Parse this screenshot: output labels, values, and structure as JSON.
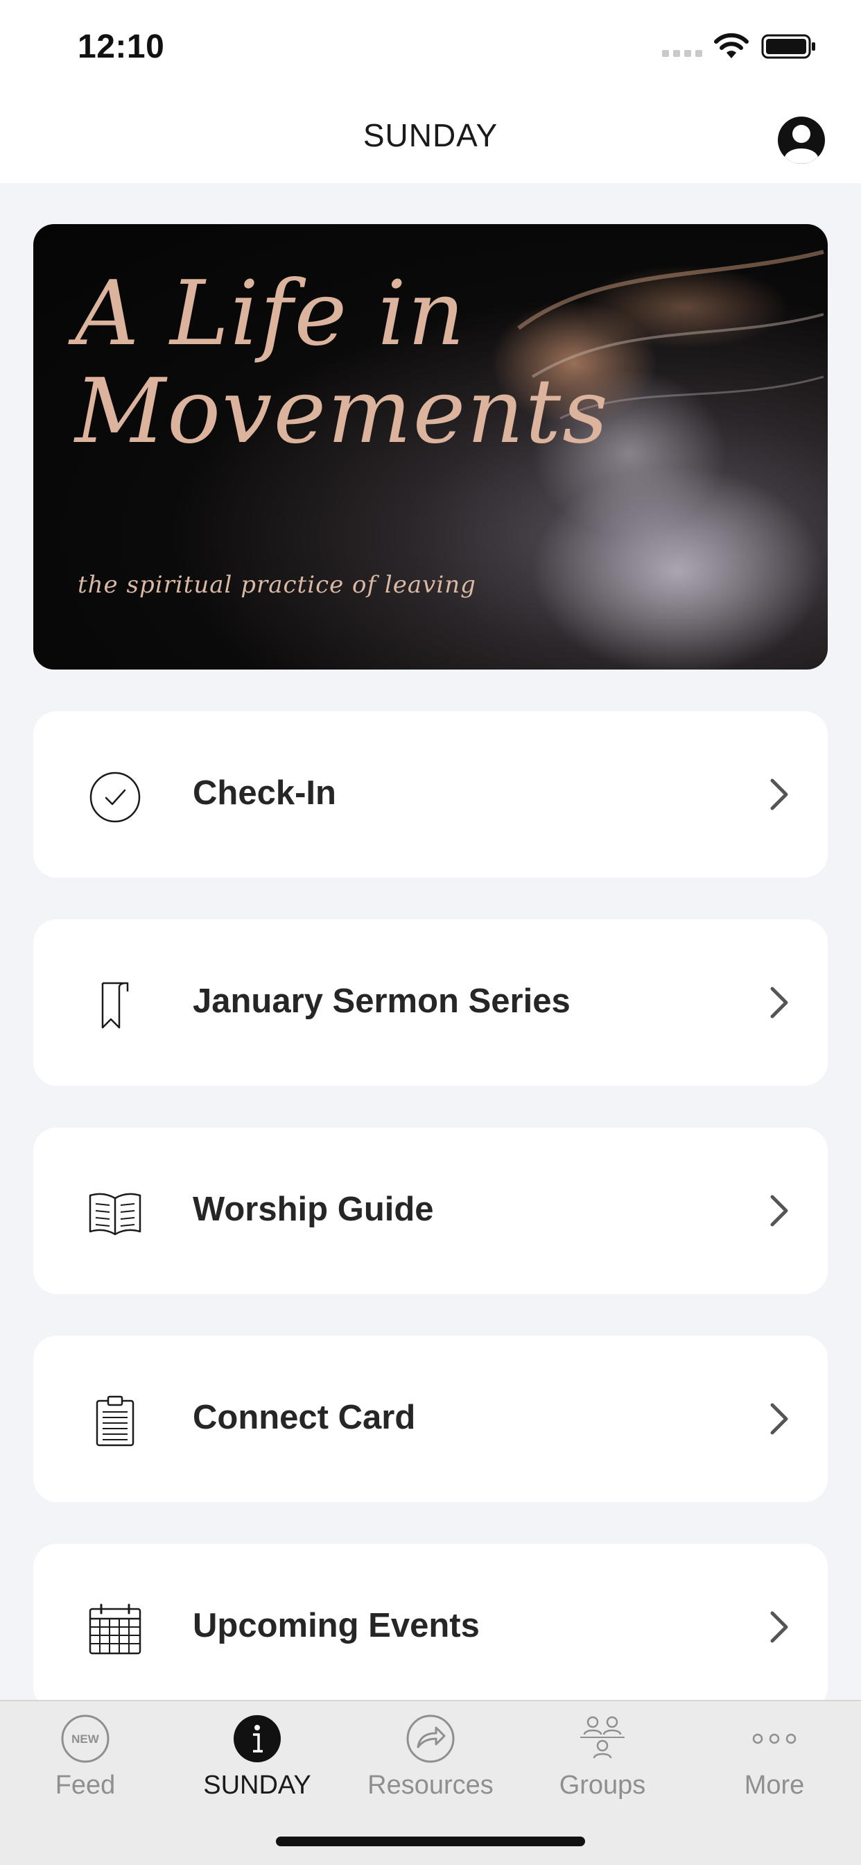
{
  "status_bar": {
    "time": "12:10"
  },
  "nav": {
    "title": "SUNDAY"
  },
  "hero": {
    "title_line1": "A Life in",
    "title_line2": "Movements",
    "subtitle": "the spiritual practice of leaving"
  },
  "menu": [
    {
      "label": "Check-In",
      "icon": "check-circle-icon"
    },
    {
      "label": "January Sermon Series",
      "icon": "bookmark-icon"
    },
    {
      "label": "Worship Guide",
      "icon": "open-book-icon"
    },
    {
      "label": "Connect Card",
      "icon": "clipboard-icon"
    },
    {
      "label": "Upcoming Events",
      "icon": "calendar-icon"
    }
  ],
  "tabs": [
    {
      "label": "Feed",
      "icon": "new-badge-icon",
      "badge_text": "NEW",
      "active": false
    },
    {
      "label": "SUNDAY",
      "icon": "info-icon",
      "active": true
    },
    {
      "label": "Resources",
      "icon": "share-arrow-icon",
      "active": false
    },
    {
      "label": "Groups",
      "icon": "groups-icon",
      "active": false
    },
    {
      "label": "More",
      "icon": "more-dots-icon",
      "active": false
    }
  ],
  "colors": {
    "background": "#f3f4f8",
    "card": "#ffffff",
    "hero_text": "#dcb39c",
    "tab_inactive": "#8f8f8f",
    "tab_active": "#1a1a1a"
  }
}
